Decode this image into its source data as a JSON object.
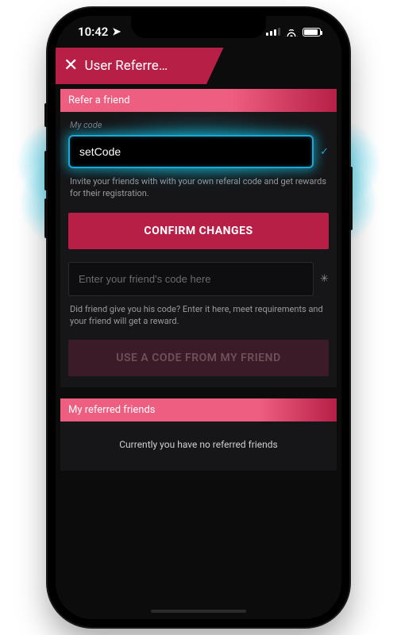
{
  "status": {
    "time": "10:42"
  },
  "header": {
    "title": "User Referre…"
  },
  "refer_section": {
    "title": "Refer a friend",
    "my_code_label": "My code",
    "code_value": "setCode",
    "helper": "Invite your friends with with your own referal code and get rewards for their registration.",
    "confirm_label": "CONFIRM CHANGES"
  },
  "friend_code_section": {
    "placeholder": "Enter your friend's code here",
    "helper": "Did friend give you his code? Enter it here, meet requirements and your friend will get a reward.",
    "use_code_label": "USE A CODE FROM MY FRIEND"
  },
  "referred_section": {
    "title": "My referred friends",
    "empty_message": "Currently you have no referred friends"
  }
}
